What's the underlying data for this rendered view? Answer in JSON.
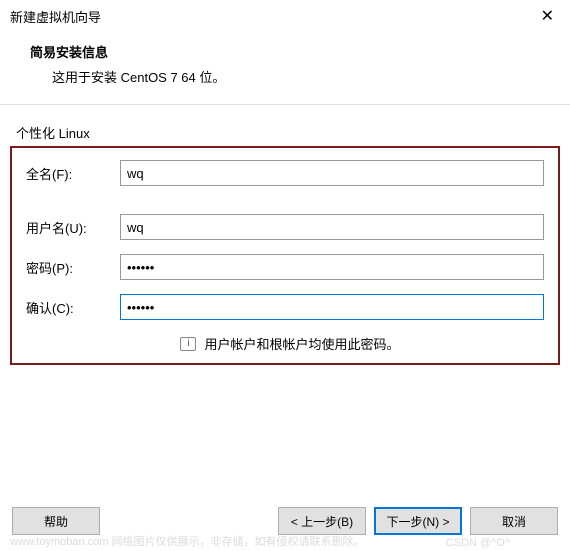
{
  "window": {
    "title": "新建虚拟机向导"
  },
  "header": {
    "title": "简易安装信息",
    "subtitle": "这用于安装 CentOS 7 64 位。"
  },
  "group": {
    "label": "个性化 Linux"
  },
  "form": {
    "fullname_label": "全名(F):",
    "fullname_value": "wq",
    "username_label": "用户名(U):",
    "username_value": "wq",
    "password_label": "密码(P):",
    "password_value": "••••••",
    "confirm_label": "确认(C):",
    "confirm_value": "••••••",
    "note": "用户帐户和根帐户均使用此密码。"
  },
  "buttons": {
    "help": "帮助",
    "back": "< 上一步(B)",
    "next": "下一步(N) >",
    "cancel": "取消"
  },
  "watermark": {
    "left": "www.toymoban.com  网络图片仅供展示，非存储，如有侵权请联系删除。",
    "right": "CSDN @^O^"
  }
}
